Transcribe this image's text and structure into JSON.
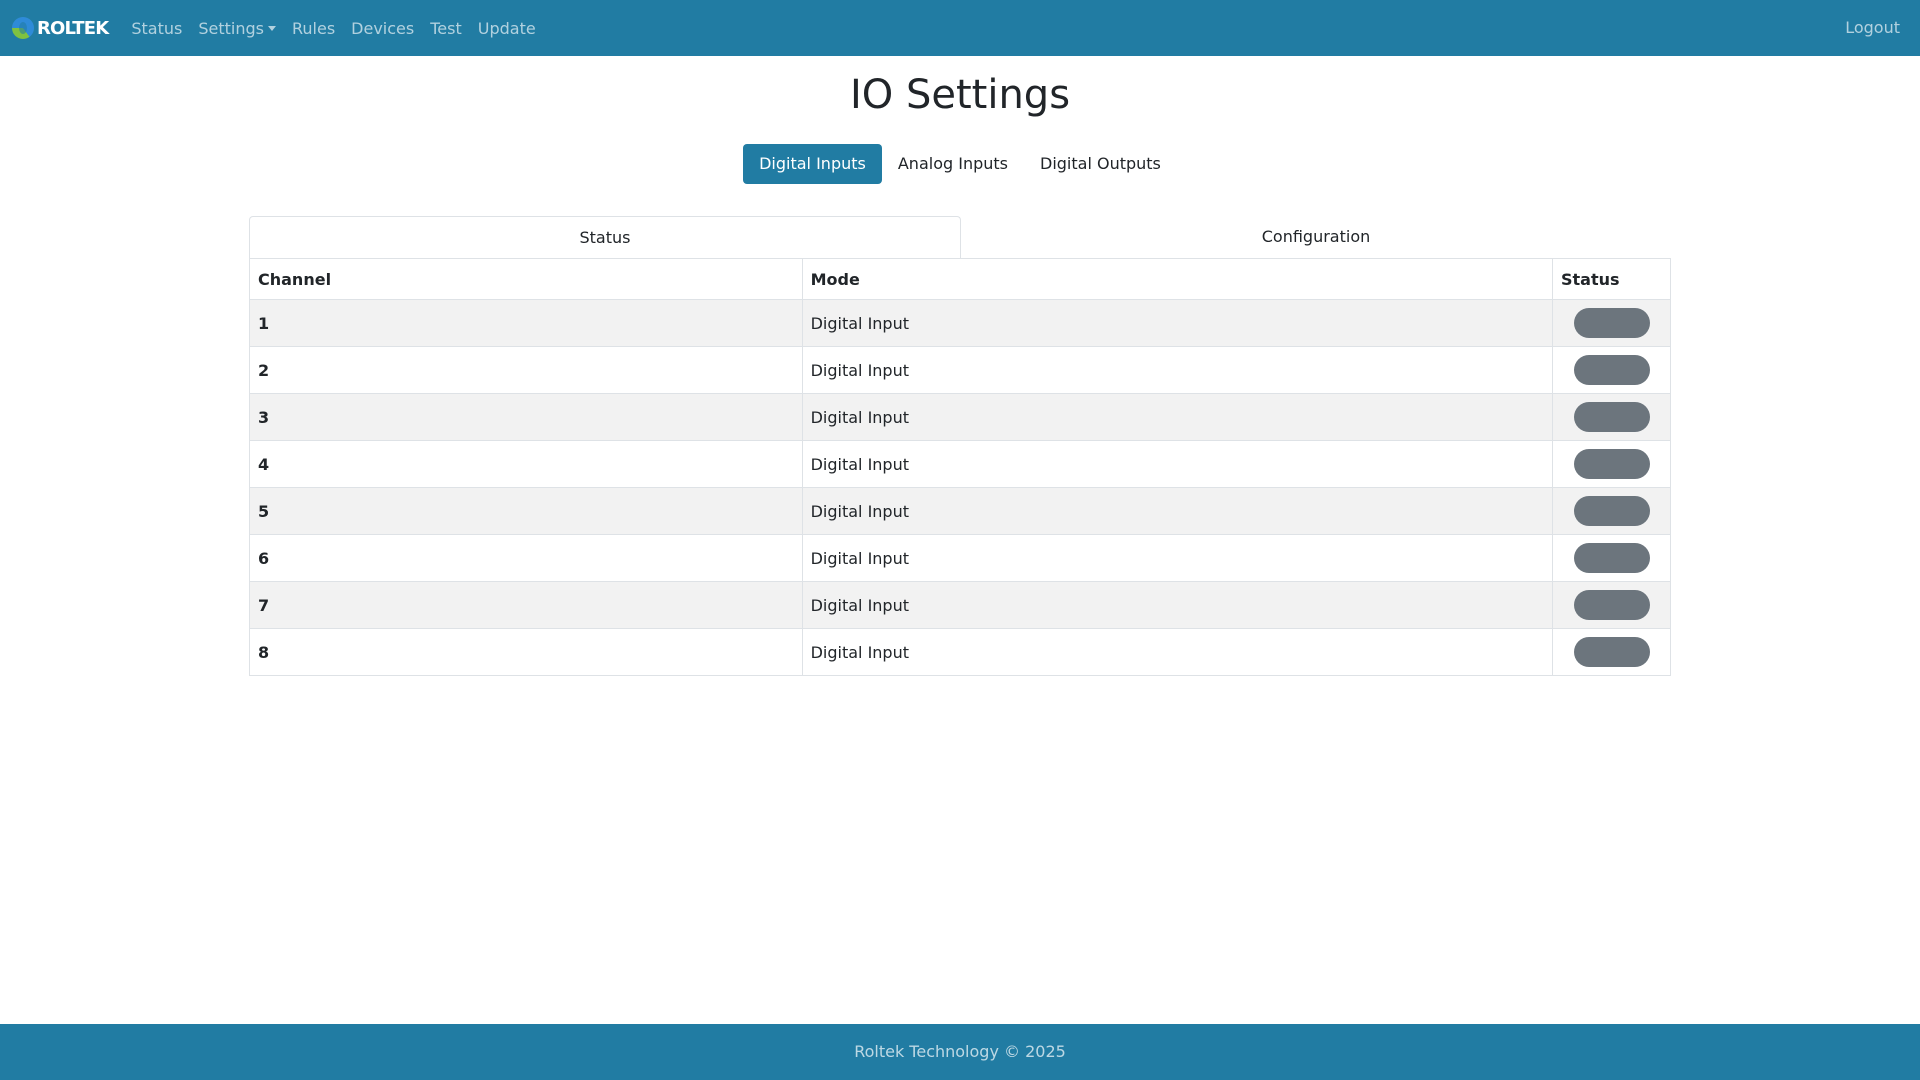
{
  "nav": {
    "brand": "ROLTEK",
    "links": [
      "Status",
      "Settings",
      "Rules",
      "Devices",
      "Test",
      "Update"
    ],
    "logout": "Logout"
  },
  "page": {
    "title": "IO Settings"
  },
  "pills": [
    "Digital Inputs",
    "Analog Inputs",
    "Digital Outputs"
  ],
  "tabs": [
    "Status",
    "Configuration"
  ],
  "table": {
    "headers": [
      "Channel",
      "Mode",
      "Status"
    ],
    "rows": [
      {
        "channel": "1",
        "mode": "Digital Input"
      },
      {
        "channel": "2",
        "mode": "Digital Input"
      },
      {
        "channel": "3",
        "mode": "Digital Input"
      },
      {
        "channel": "4",
        "mode": "Digital Input"
      },
      {
        "channel": "5",
        "mode": "Digital Input"
      },
      {
        "channel": "6",
        "mode": "Digital Input"
      },
      {
        "channel": "7",
        "mode": "Digital Input"
      },
      {
        "channel": "8",
        "mode": "Digital Input"
      }
    ]
  },
  "footer": {
    "text": "Roltek Technology © 2025"
  },
  "colors": {
    "primary": "#217ca3",
    "status_off": "#6c757d"
  },
  "icons": {
    "brand": "roltek-logo-icon",
    "dropdown": "chevron-down-icon"
  }
}
